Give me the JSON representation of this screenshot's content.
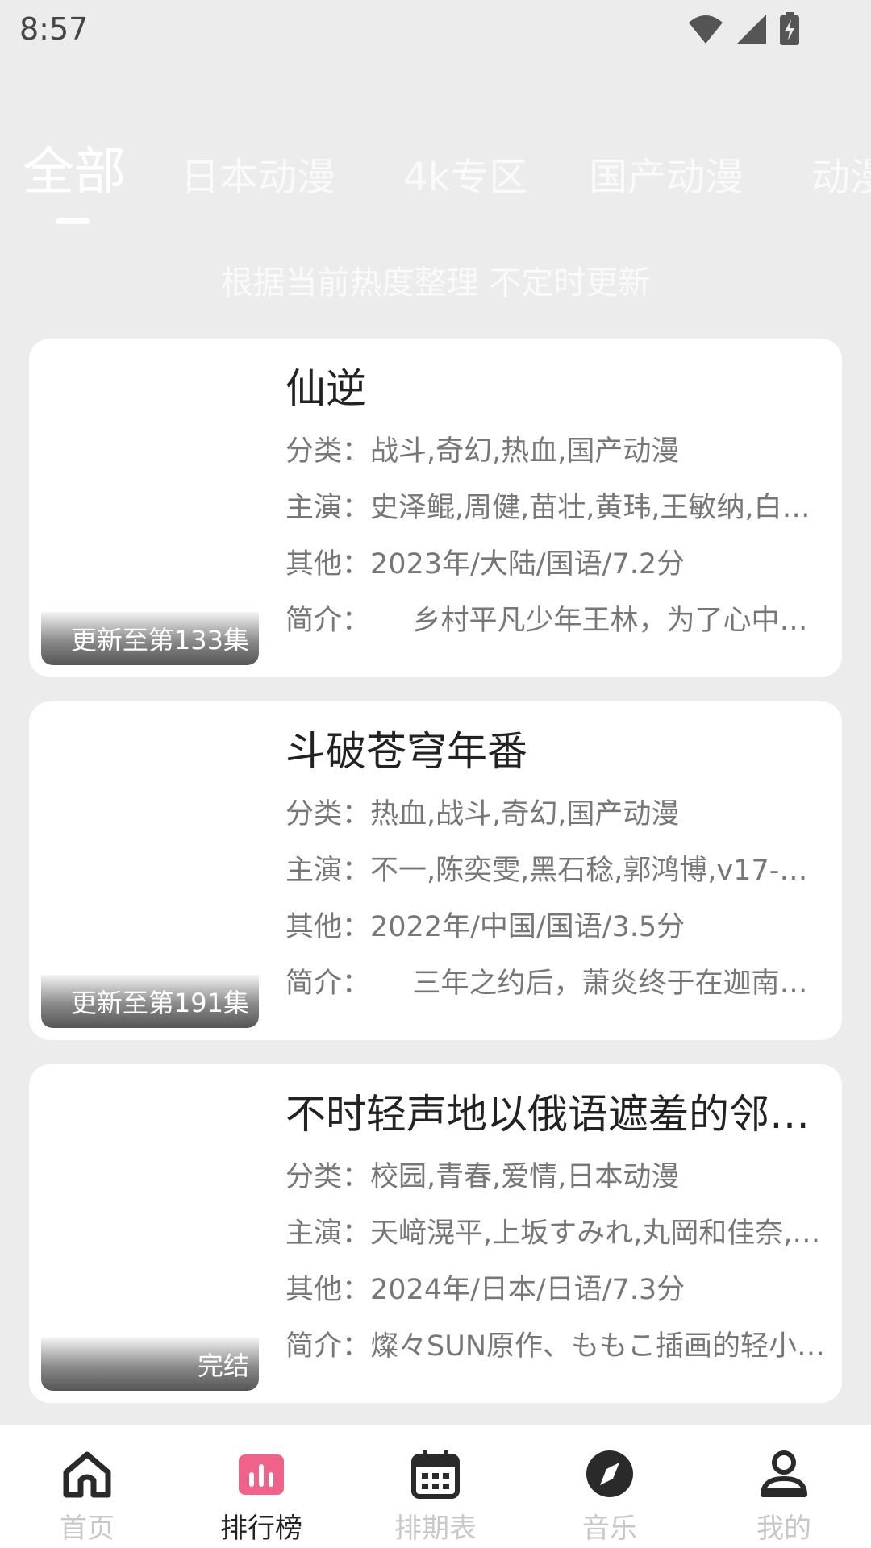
{
  "status_bar": {
    "time": "8:57"
  },
  "tabs": [
    {
      "label": "全部",
      "active": true
    },
    {
      "label": "日本动漫"
    },
    {
      "label": "4k专区"
    },
    {
      "label": "国产动漫"
    },
    {
      "label": "动漫"
    }
  ],
  "subtitle": "根据当前热度整理 不定时更新",
  "labels": {
    "category": "分类：",
    "cast": "主演：",
    "other": "其他：",
    "intro": "简介："
  },
  "cards": [
    {
      "title": "仙逆",
      "badge": "更新至第133集",
      "category": "战斗,奇幻,热血,国产动漫",
      "cast": "史泽鲲,周健,苗壮,黄玮,王敏纳,白雪…",
      "other": "2023年/大陆/国语/7.2分",
      "intro": "　　乡村平凡少年王林，为了心中…"
    },
    {
      "title": "斗破苍穹年番",
      "badge": "更新至第191集",
      "category": "热血,战斗,奇幻,国产动漫",
      "cast": "不一,陈奕雯,黑石稔,郭鸿博,v17-富…",
      "other": "2022年/中国/国语/3.5分",
      "intro": "　　三年之约后，萧炎终于在迦南…"
    },
    {
      "title": "不时轻声地以俄语遮羞的邻座…",
      "badge": "完结",
      "category": "校园,青春,爱情,日本动漫",
      "cast": "天﨑滉平,上坂すみれ,丸岡和佳奈,…",
      "other": "2024年/日本/日语/7.3分",
      "intro": "燦々SUN原作、ももこ插画的轻小…"
    }
  ],
  "nav": [
    {
      "label": "首页",
      "icon": "home-icon"
    },
    {
      "label": "排行榜",
      "icon": "ranking-icon",
      "active": true
    },
    {
      "label": "排期表",
      "icon": "calendar-icon"
    },
    {
      "label": "音乐",
      "icon": "compass-icon"
    },
    {
      "label": "我的",
      "icon": "profile-icon"
    }
  ],
  "colors": {
    "accent": "#f0628a",
    "inactive": "#c8c8c8"
  }
}
